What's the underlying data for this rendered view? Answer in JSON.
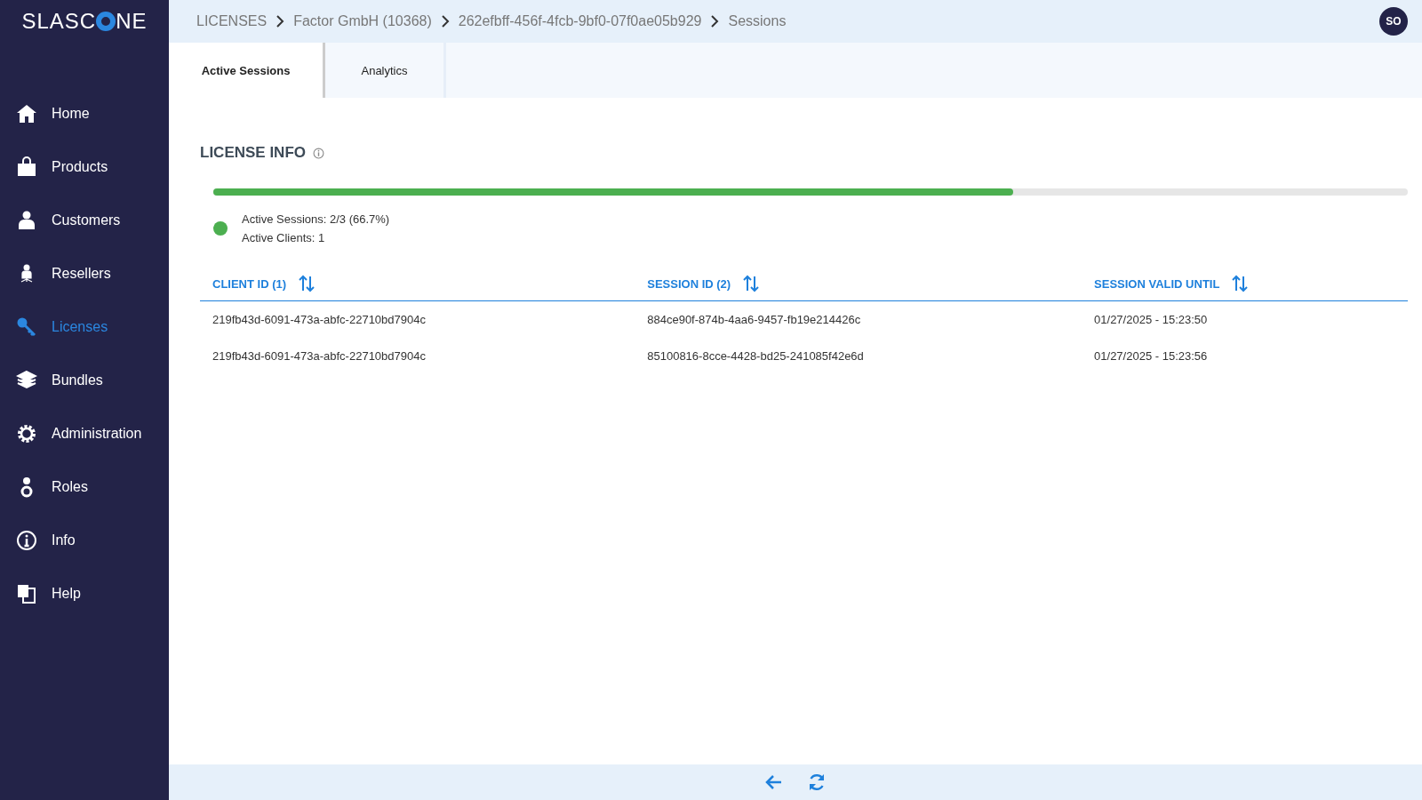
{
  "logo": {
    "left": "SLASC",
    "right": "NE"
  },
  "sidebar": {
    "items": [
      {
        "label": "Home",
        "selected": false
      },
      {
        "label": "Products",
        "selected": false
      },
      {
        "label": "Customers",
        "selected": false
      },
      {
        "label": "Resellers",
        "selected": false
      },
      {
        "label": "Licenses",
        "selected": true
      },
      {
        "label": "Bundles",
        "selected": false
      },
      {
        "label": "Administration",
        "selected": false
      },
      {
        "label": "Roles",
        "selected": false
      },
      {
        "label": "Info",
        "selected": false
      },
      {
        "label": "Help",
        "selected": false
      }
    ]
  },
  "breadcrumb": [
    "LICENSES",
    "Factor GmbH (10368)",
    "262efbff-456f-4fcb-9bf0-07f0ae05b929",
    "Sessions"
  ],
  "user": {
    "initials": "SO"
  },
  "tabs": [
    {
      "label": "Active Sessions",
      "selected": true
    },
    {
      "label": "Analytics",
      "selected": false
    }
  ],
  "license_info": {
    "title": "LICENSE INFO",
    "level": 0.67,
    "lines": [
      "Active Sessions: 2/3 (66.7%)",
      "Active Clients: 1"
    ]
  },
  "table": {
    "columns": [
      "CLIENT ID (1)",
      "SESSION ID (2)",
      "SESSION VALID UNTIL"
    ],
    "rows": [
      [
        "219fb43d-6091-473a-abfc-22710bd7904c",
        "884ce90f-874b-4aa6-9457-fb19e214426c",
        "01/27/2025 - 15:23:50"
      ],
      [
        "219fb43d-6091-473a-abfc-22710bd7904c",
        "85100816-8cce-4428-bd25-241085f42e6d",
        "01/27/2025 - 15:23:56"
      ]
    ]
  }
}
